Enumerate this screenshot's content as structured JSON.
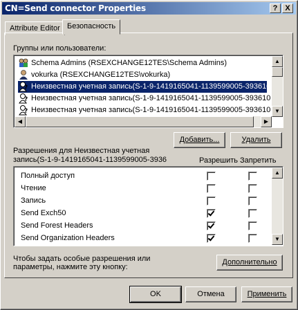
{
  "window": {
    "title": "CN=Send connector Properties",
    "help_glyph": "?",
    "close_glyph": "X"
  },
  "tabs": [
    {
      "label": "Attribute Editor",
      "active": false
    },
    {
      "label": "Безопасность",
      "active": true
    }
  ],
  "groups": {
    "label": "Группы или пользователи:",
    "items": [
      {
        "text": "Schema Admins (RSEXCHANGE12TES\\Schema Admins)",
        "icon": "group-icon",
        "selected": false
      },
      {
        "text": "vokurka (RSEXCHANGE12TES\\vokurka)",
        "icon": "user-icon",
        "selected": false
      },
      {
        "text": "Неизвестная учетная запись(S-1-9-1419165041-1139599005-393610",
        "icon": "unknown-account-icon",
        "selected": true
      },
      {
        "text": "Неизвестная учетная запись(S-1-9-1419165041-1139599005-393610",
        "icon": "unknown-account-icon",
        "selected": false
      },
      {
        "text": "Неизвестная учетная запись(S-1-9-1419165041-1139599005-393610",
        "icon": "unknown-account-icon",
        "selected": false
      }
    ]
  },
  "buttons": {
    "add": "Добавить...",
    "remove": "Удалить",
    "advanced": "Дополнительно",
    "ok": "OK",
    "cancel": "Отмена",
    "apply": "Применить"
  },
  "permissions": {
    "label_line1": "Разрешения для Неизвестная учетная",
    "label_line2": "запись(S-1-9-1419165041-1139599005-3936",
    "allow_header": "Разрешить",
    "deny_header": "Запретить",
    "rows": [
      {
        "name": "Полный доступ",
        "allow": false,
        "deny": false
      },
      {
        "name": "Чтение",
        "allow": false,
        "deny": false
      },
      {
        "name": "Запись",
        "allow": false,
        "deny": false
      },
      {
        "name": "Send Exch50",
        "allow": true,
        "deny": false
      },
      {
        "name": "Send Forest Headers",
        "allow": true,
        "deny": false
      },
      {
        "name": "Send Organization Headers",
        "allow": true,
        "deny": false
      }
    ]
  },
  "special": {
    "line1": "Чтобы задать особые разрешения или",
    "line2": "параметры, нажмите эту кнопку:"
  }
}
